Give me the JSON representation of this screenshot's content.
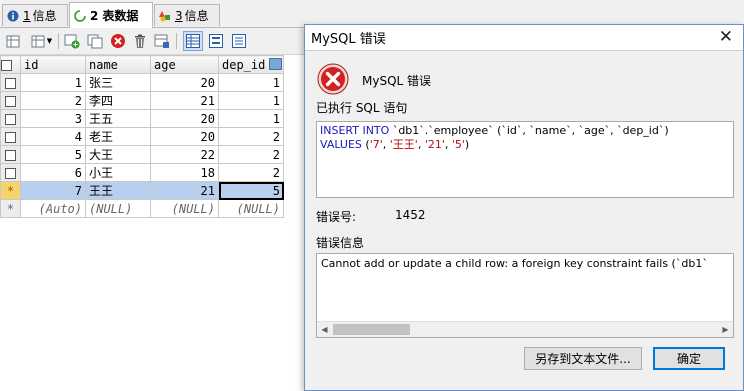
{
  "tabs": [
    {
      "num": "1",
      "label": "信息"
    },
    {
      "num": "2",
      "label": "表数据"
    },
    {
      "num": "3",
      "label": "信息"
    }
  ],
  "grid": {
    "columns": [
      "id",
      "name",
      "age",
      "dep_id"
    ],
    "rows": [
      {
        "id": "1",
        "name": "张三",
        "age": "20",
        "dep_id": "1"
      },
      {
        "id": "2",
        "name": "李四",
        "age": "21",
        "dep_id": "1"
      },
      {
        "id": "3",
        "name": "王五",
        "age": "20",
        "dep_id": "1"
      },
      {
        "id": "4",
        "name": "老王",
        "age": "20",
        "dep_id": "2"
      },
      {
        "id": "5",
        "name": "大王",
        "age": "22",
        "dep_id": "2"
      },
      {
        "id": "6",
        "name": "小王",
        "age": "18",
        "dep_id": "2"
      },
      {
        "id": "7",
        "name": "王王",
        "age": "21",
        "dep_id": "5"
      }
    ],
    "current_row_marker": "*",
    "new_row": {
      "marker": "*",
      "id": "(Auto)",
      "name": "(NULL)",
      "age": "(NULL)",
      "dep_id": "(NULL)"
    }
  },
  "dialog": {
    "title": "MySQL 错误",
    "close_glyph": "✕",
    "header": "MySQL 错误",
    "executed_label": "已执行 SQL 语句",
    "sql": {
      "line1_kw1": "INSERT INTO",
      "line1_rest": " `db1`.`employee` (`id`, `name`, `age`, `dep_id`)",
      "line2_kw": "VALUES",
      "line2_open": " (",
      "v1": "'7'",
      "v2": "'王王'",
      "v3": "'21'",
      "v4": "'5'",
      "comma": ", ",
      "close": ")"
    },
    "errno_label": "错误号:",
    "errno_value": "1452",
    "errinfo_label": "错误信息",
    "error_message": "Cannot add or update a child row: a foreign key constraint fails (`db1`",
    "save_button": "另存到文本文件...",
    "ok_button": "确定"
  },
  "colors": {
    "selected_row": "#b8cfee",
    "sql_keyword": "#1a1ab5",
    "sql_string": "#b01010",
    "error_red": "#d32020"
  }
}
